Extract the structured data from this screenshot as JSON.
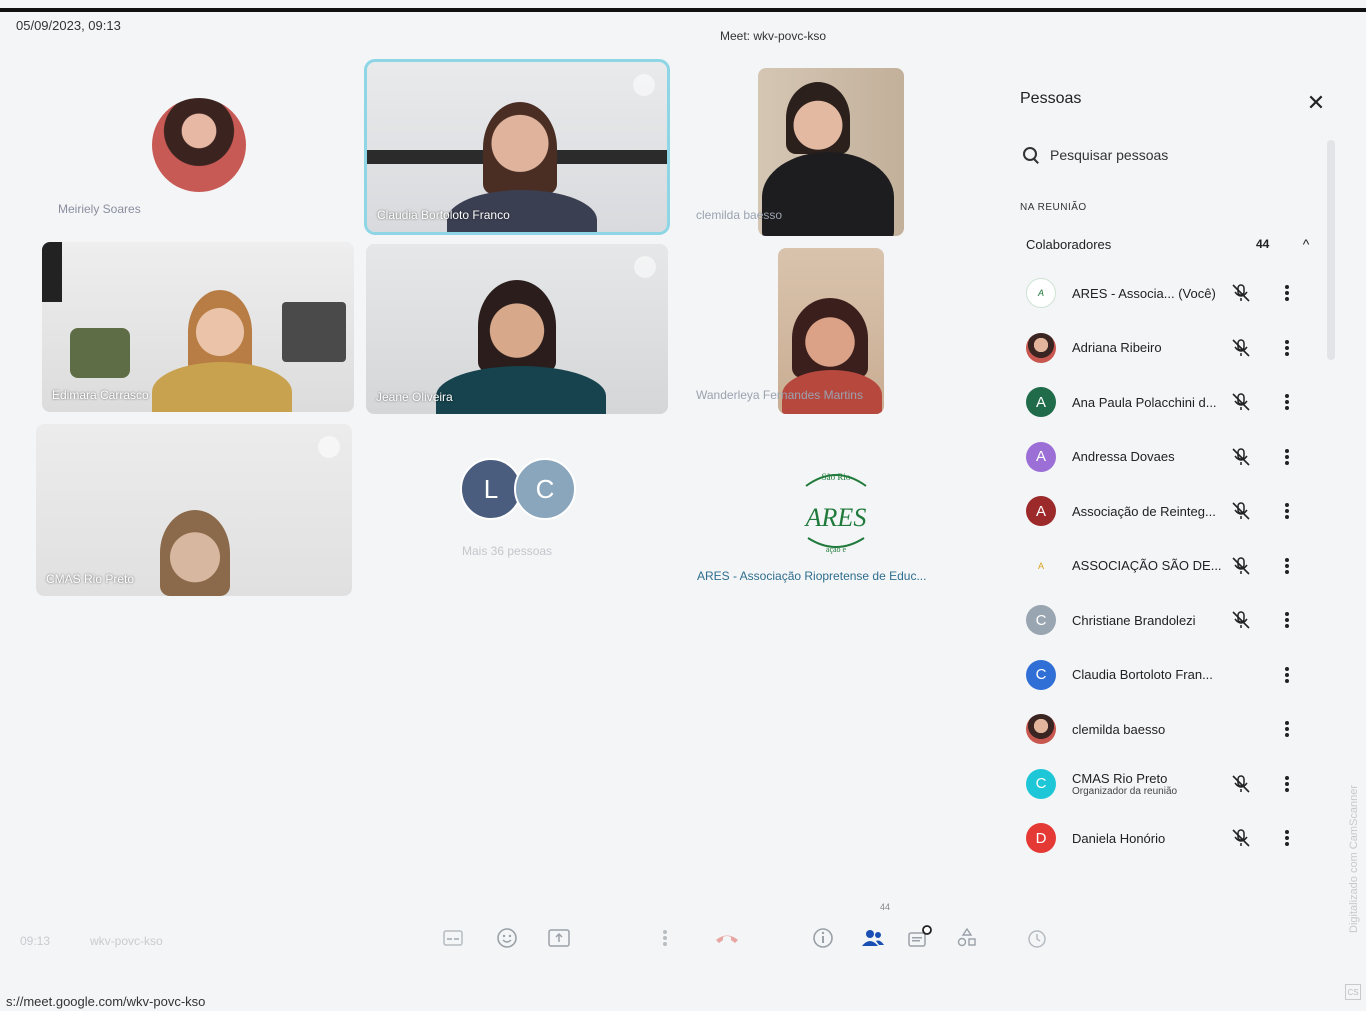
{
  "scan": {
    "timestamp": "05/09/2023, 09:13",
    "url": "s://meet.google.com/wkv-povc-kso",
    "watermark": "Digitalizado com CamScanner",
    "badge": "CS"
  },
  "meeting": {
    "header_title": "Meet: wkv-povc-kso",
    "bottom_time": "09:13",
    "bottom_code": "wkv-povc-kso"
  },
  "tiles": {
    "meiriely": "Meiriely Soares",
    "claudia": "Claudia Bortoloto Franco",
    "clemilda": "clemilda baesso",
    "edimara": "Edimara Carrasco",
    "jeane": "Jeane Oliveira",
    "wanderleya": "Wanderleya Fernandes Martins",
    "cmas": "CMAS Rio Preto",
    "more_initial_1": "L",
    "more_initial_2": "C",
    "more_people": "Mais 36 pessoas",
    "ares_caption": "ARES - Associação Riopretense de Educ...",
    "ares_logo_text": "ARES",
    "ares_logo_arc_top": "São Rio",
    "ares_logo_arc_bottom": "ação e"
  },
  "panel": {
    "title": "Pessoas",
    "search_placeholder": "Pesquisar pessoas",
    "section_label": "NA REUNIÃO",
    "group_name": "Colaboradores",
    "group_count": "44",
    "participants": [
      {
        "name": "ARES - Associa... (Você)",
        "avatar": "ares",
        "initial": "",
        "muted": true
      },
      {
        "name": "Adriana Ribeiro",
        "avatar": "photo",
        "initial": "",
        "muted": true
      },
      {
        "name": "Ana Paula Polacchini d...",
        "avatar": "letter",
        "initial": "A",
        "muted": true
      },
      {
        "name": "Andressa Dovaes",
        "avatar": "letter",
        "initial": "A",
        "muted": true
      },
      {
        "name": "Associação de Reinteg...",
        "avatar": "letter",
        "initial": "A",
        "muted": true
      },
      {
        "name": "ASSOCIAÇÃO SÃO DE...",
        "avatar": "logo",
        "initial": "",
        "muted": true
      },
      {
        "name": "Christiane Brandolezi",
        "avatar": "letter",
        "initial": "C",
        "muted": true
      },
      {
        "name": "Claudia Bortoloto Fran...",
        "avatar": "letter",
        "initial": "C",
        "muted": false
      },
      {
        "name": "clemilda baesso",
        "avatar": "photo",
        "initial": "",
        "muted": false
      },
      {
        "name": "CMAS Rio Preto",
        "sub": "Organizador da reunião",
        "avatar": "letter",
        "initial": "C",
        "muted": true
      },
      {
        "name": "Daniela Honório",
        "avatar": "letter",
        "initial": "D",
        "muted": true
      }
    ]
  },
  "toolbar": {
    "people_count": "44"
  },
  "colors": {
    "active_outline": "#8ed6e6",
    "avatar_green": "#1f6b4a",
    "avatar_purple": "#9b6fd6",
    "avatar_maroon": "#9c2a2a",
    "avatar_grey": "#9aa5b2",
    "avatar_blue": "#2f6fd6",
    "avatar_cyan": "#1ec7d8",
    "avatar_red": "#e53935",
    "people_icon_blue": "#1a4fb3"
  }
}
